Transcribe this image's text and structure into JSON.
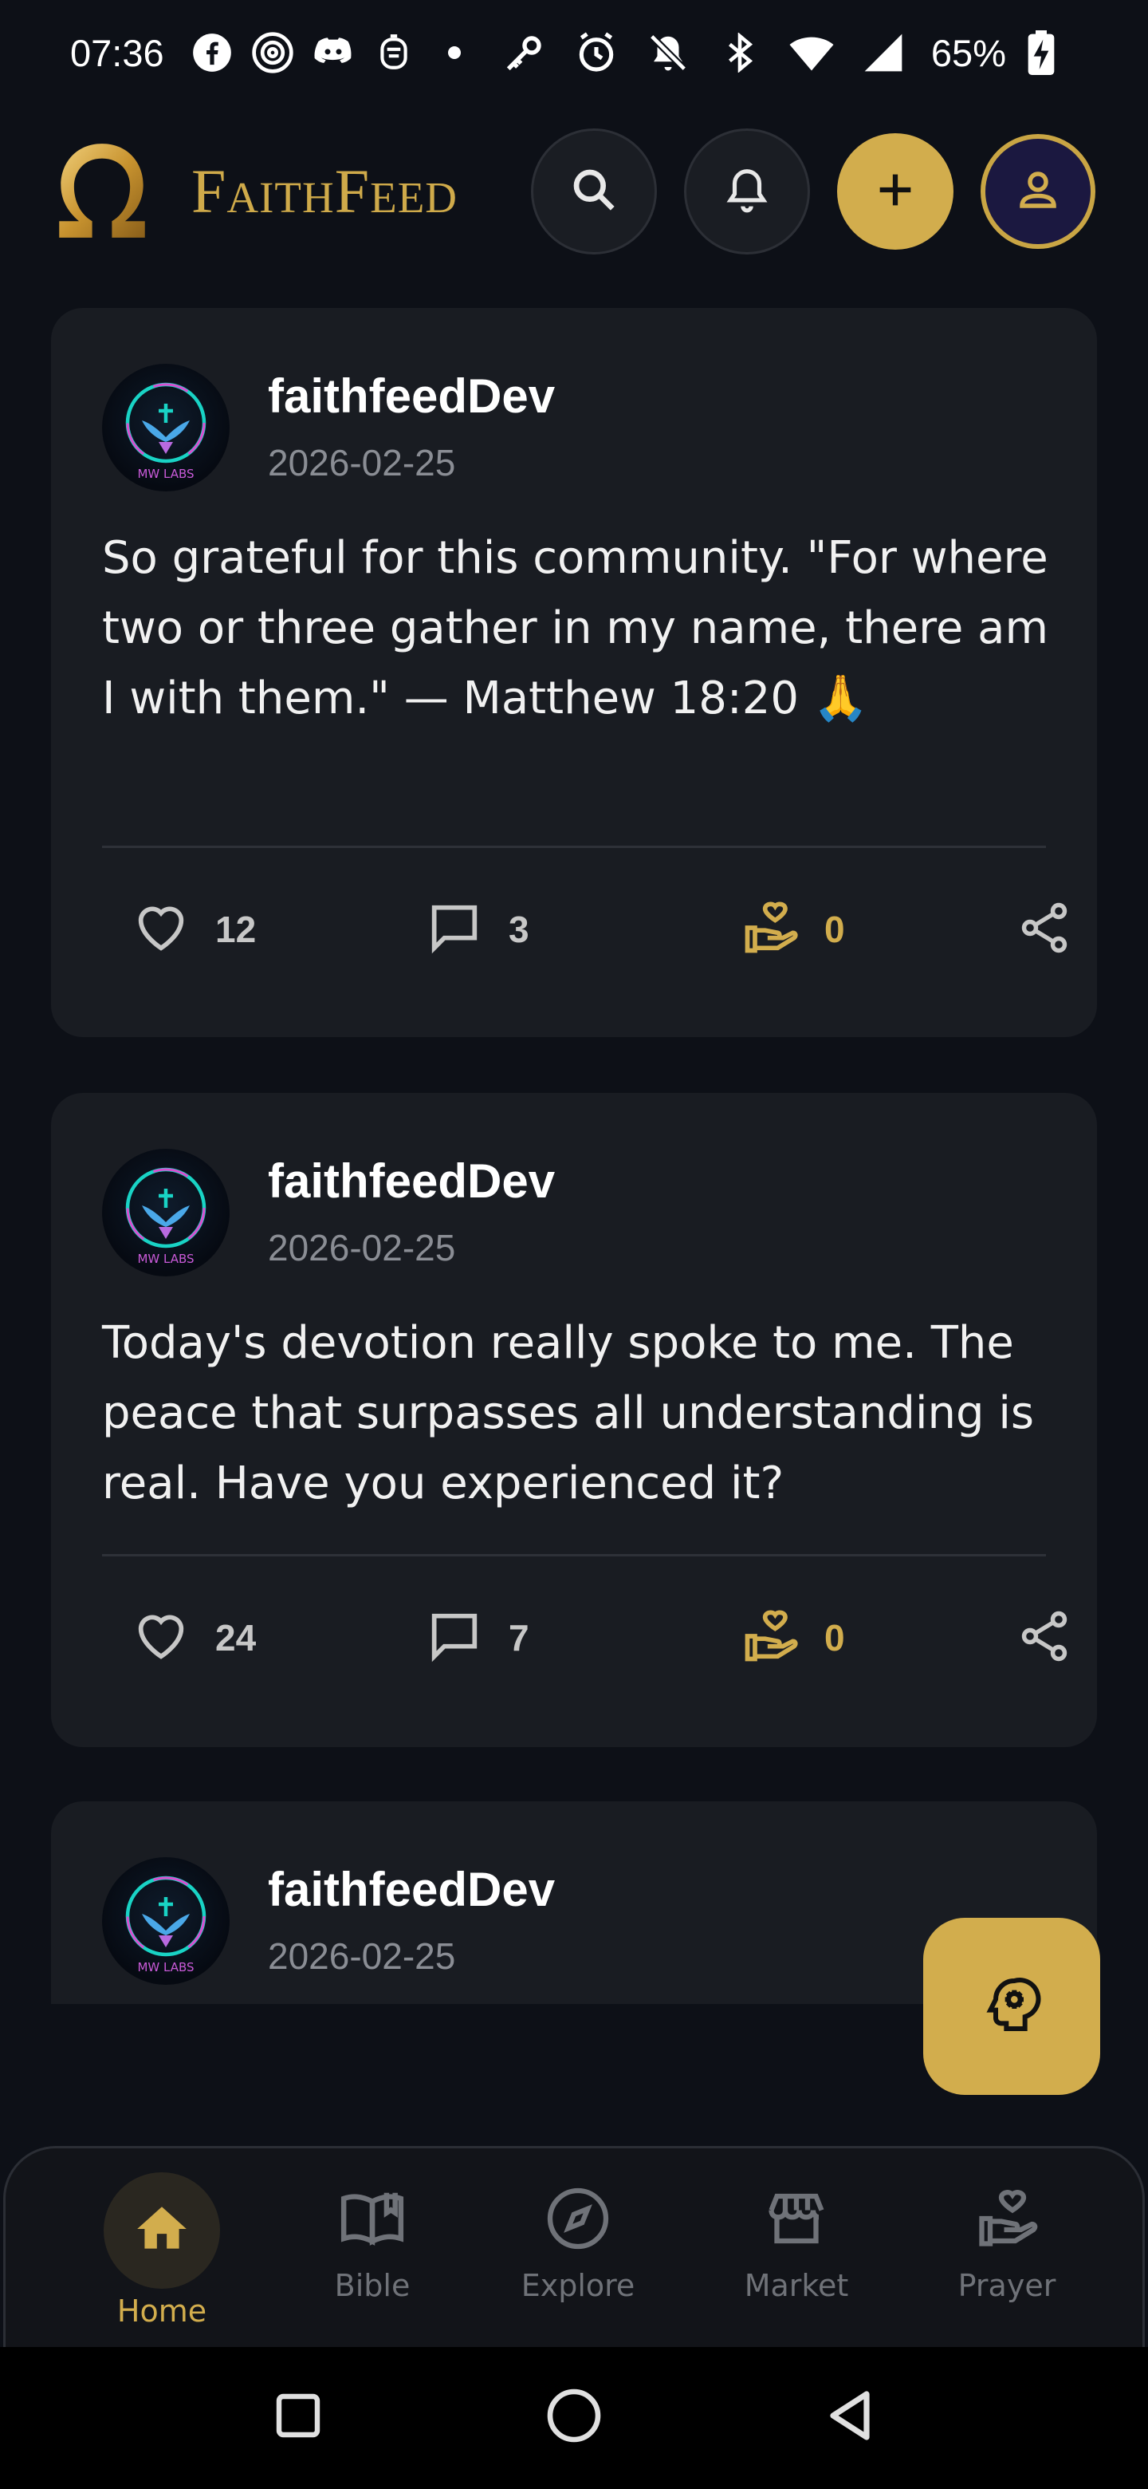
{
  "status_bar": {
    "time": "07:36",
    "battery": "65%",
    "left_icons": [
      "facebook-icon",
      "threads-icon",
      "discord-icon",
      "shield-app-icon",
      "dot-icon"
    ],
    "right_icons": [
      "key-icon",
      "alarm-icon",
      "bell-off-icon",
      "bluetooth-icon",
      "wifi-icon",
      "signal-icon",
      "battery-charging-icon"
    ]
  },
  "header": {
    "brand": "FaithFeed",
    "logo_icon": "omega-logo-icon",
    "actions": [
      "search-icon",
      "bell-icon",
      "plus-icon",
      "user-icon"
    ]
  },
  "colors": {
    "accent": "#d2ad4d",
    "card_bg": "#191c22",
    "page_bg": "#0d1017"
  },
  "posts": [
    {
      "author": "faithfeedDev",
      "date": "2026-02-25",
      "body": "So grateful for this community. \"For where two or three gather in my name, there am I with them.\" — Matthew 18:20 🙏",
      "likes": "12",
      "comments": "3",
      "prayers": "0"
    },
    {
      "author": "faithfeedDev",
      "date": "2026-02-25",
      "body": "Today's devotion really spoke to me. The peace that surpasses all understanding is real. Have you experienced it?",
      "likes": "24",
      "comments": "7",
      "prayers": "0"
    },
    {
      "author": "faithfeedDev",
      "date": "2026-02-25"
    }
  ],
  "fab": {
    "icon": "ai-brain-icon"
  },
  "bottom_nav": {
    "items": [
      {
        "label": "Home",
        "icon": "home-icon",
        "active": true
      },
      {
        "label": "Bible",
        "icon": "book-icon",
        "active": false
      },
      {
        "label": "Explore",
        "icon": "compass-icon",
        "active": false
      },
      {
        "label": "Market",
        "icon": "store-icon",
        "active": false
      },
      {
        "label": "Prayer",
        "icon": "prayer-hands-icon",
        "active": false
      }
    ]
  }
}
